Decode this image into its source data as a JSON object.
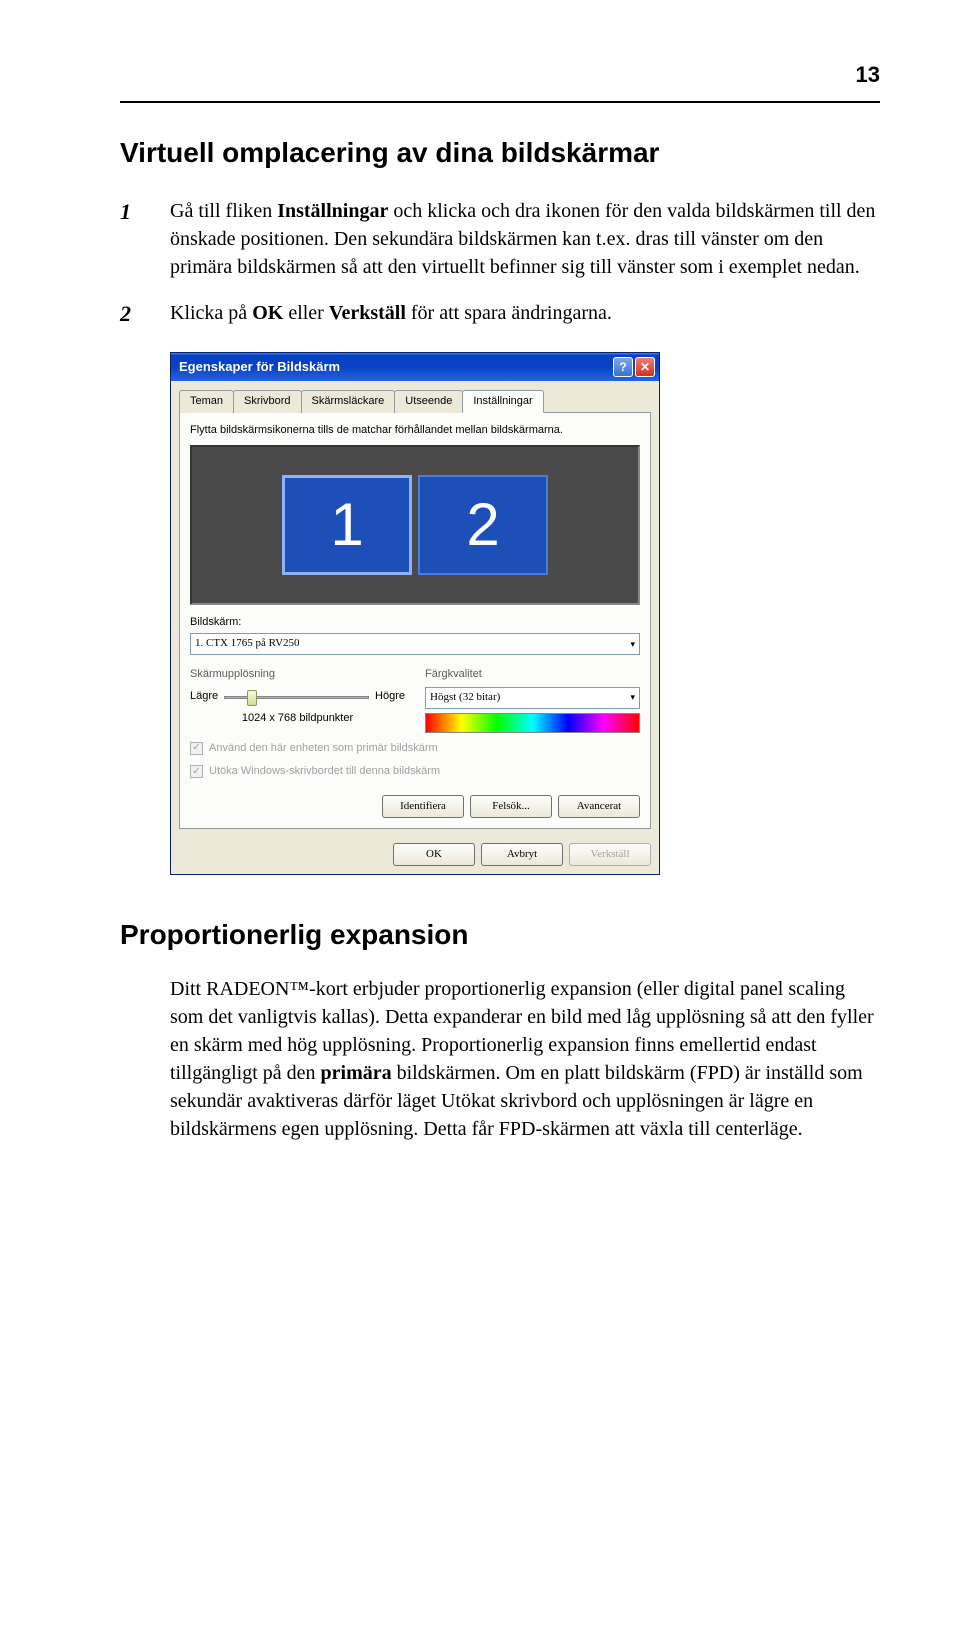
{
  "page_number": "13",
  "heading_main": "Virtuell omplacering av dina bildskärmar",
  "steps": [
    {
      "num": "1",
      "text_prefix": "Gå till fliken ",
      "bold1": "Inställningar",
      "text_mid": " och klicka och dra ikonen för den valda bildskärmen till den önskade positionen. Den sekundära bildskärmen kan t.ex. dras till vänster om den primära bildskärmen så att den virtuellt befinner sig till vänster som i exemplet nedan."
    },
    {
      "num": "2",
      "text_prefix": "Klicka på ",
      "bold1": "OK",
      "text_mid": " eller ",
      "bold2": "Verkställ",
      "text_end": " för att spara ändringarna."
    }
  ],
  "dialog": {
    "title": "Egenskaper för Bildskärm",
    "tabs": [
      "Teman",
      "Skrivbord",
      "Skärmsläckare",
      "Utseende",
      "Inställningar"
    ],
    "active_tab": "Inställningar",
    "hint": "Flytta bildskärmsikonerna tills de matchar förhållandet mellan bildskärmarna.",
    "monitors": [
      "1",
      "2"
    ],
    "display_label": "Bildskärm:",
    "display_value": "1. CTX 1765 på RV250",
    "res_group": "Skärmupplösning",
    "res_low": "Lägre",
    "res_high": "Högre",
    "res_text": "1024 x 768 bildpunkter",
    "color_group": "Färgkvalitet",
    "color_value": "Högst (32 bitar)",
    "check1": "Använd den här enheten som primär bildskärm",
    "check2": "Utöka Windows-skrivbordet till denna bildskärm",
    "btn_identify": "Identifiera",
    "btn_troubleshoot": "Felsök...",
    "btn_advanced": "Avancerat",
    "btn_ok": "OK",
    "btn_cancel": "Avbryt",
    "btn_apply": "Verkställ"
  },
  "heading_sub": "Proportionerlig expansion",
  "body_para_pre": "Ditt RADEON™-kort erbjuder proportionerlig expansion (eller digital panel scaling som det vanligtvis kallas). Detta expanderar en bild med låg upplösning så att den fyller en skärm med hög upplösning. Proportionerlig expansion finns emellertid endast tillgängligt på den ",
  "body_para_bold": "primära",
  "body_para_post": " bildskärmen. Om en platt bildskärm (FPD) är inställd som sekundär avaktiveras därför läget Utökat skrivbord och upplösningen är lägre en bildskärmens egen upplösning. Detta får FPD-skärmen att växla till centerläge."
}
